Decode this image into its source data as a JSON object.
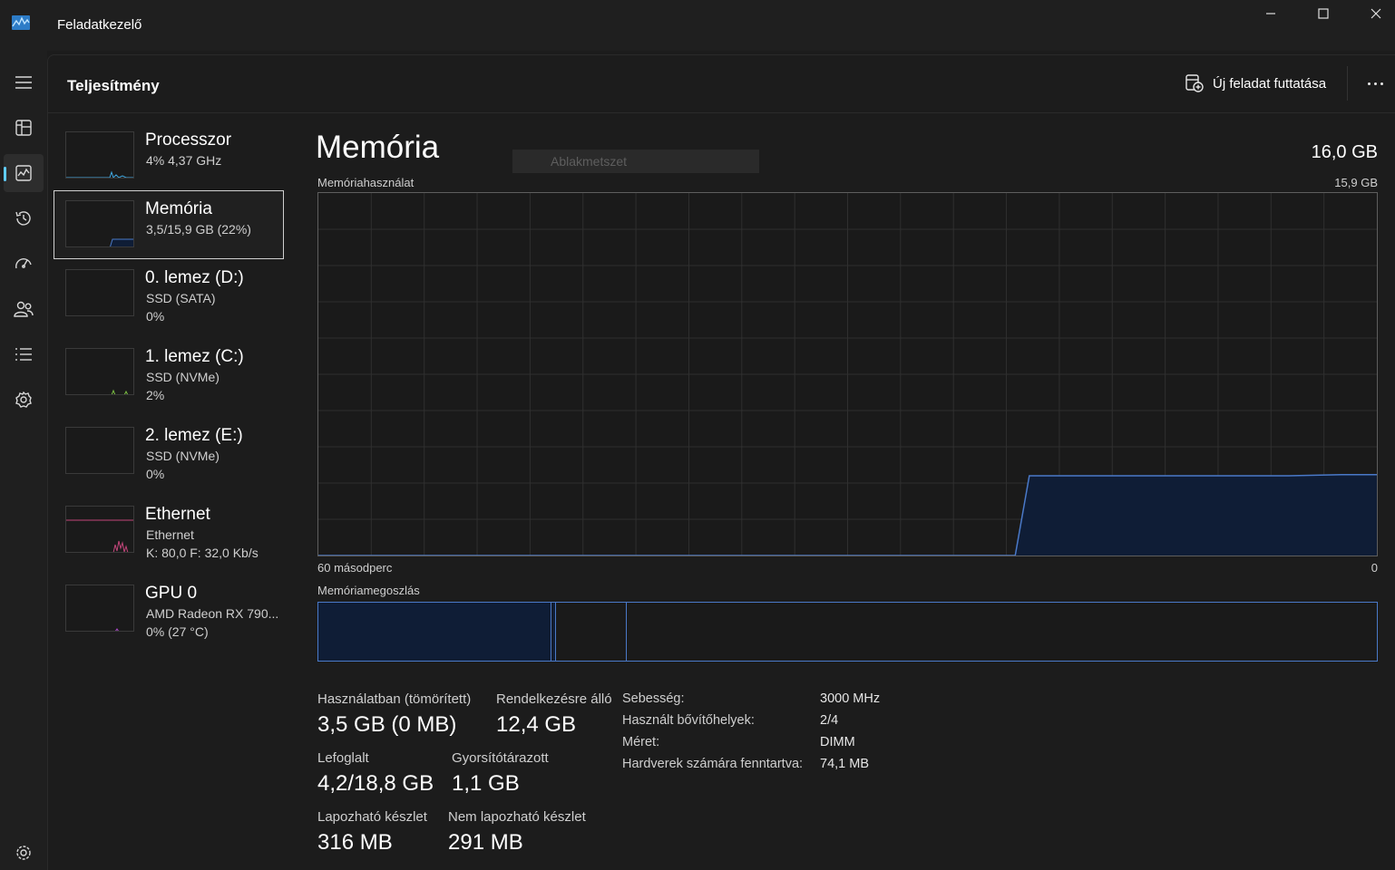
{
  "window": {
    "title": "Feladatkezelő",
    "icon": "task-manager-icon"
  },
  "rail": {
    "items": [
      {
        "name": "hamburger-menu-icon"
      },
      {
        "name": "processes-icon"
      },
      {
        "name": "performance-icon",
        "active": true
      },
      {
        "name": "app-history-icon"
      },
      {
        "name": "startup-apps-icon"
      },
      {
        "name": "users-icon"
      },
      {
        "name": "details-icon"
      },
      {
        "name": "services-icon"
      },
      {
        "name": "settings-icon"
      }
    ]
  },
  "header": {
    "title": "Teljesítmény",
    "run_task_label": "Új feladat futtatása",
    "more_icon": "more-horizontal-icon"
  },
  "resources": [
    {
      "name": "Processzor",
      "line1": "4%  4,37 GHz",
      "line2": ""
    },
    {
      "name": "Memória",
      "line1": "3,5/15,9 GB (22%)",
      "line2": "",
      "selected": true
    },
    {
      "name": "0. lemez (D:)",
      "line1": "SSD (SATA)",
      "line2": "0%"
    },
    {
      "name": "1. lemez (C:)",
      "line1": "SSD (NVMe)",
      "line2": "2%"
    },
    {
      "name": "2. lemez (E:)",
      "line1": "SSD (NVMe)",
      "line2": "0%"
    },
    {
      "name": "Ethernet",
      "line1": "Ethernet",
      "line2": "K: 80,0  F: 32,0 Kb/s"
    },
    {
      "name": "GPU 0",
      "line1": "AMD Radeon RX 790...",
      "line2": "0%  (27 °C)"
    }
  ],
  "detail": {
    "title": "Memória",
    "snapshot_label": "Ablakmetszet",
    "total": "16,0 GB",
    "usage_label": "Memóriahasználat",
    "usage_max": "15,9 GB",
    "time_left": "60 másodperc",
    "time_right": "0",
    "composition_label": "Memóriamegoszlás"
  },
  "colors": {
    "accent": "#60cdff",
    "memory_line": "#4a79c8",
    "memory_fill": "#0f1d36"
  },
  "chart_data": {
    "type": "area",
    "title": "Memóriahasználat",
    "xlabel": "",
    "ylabel": "",
    "x_range_seconds": [
      60,
      0
    ],
    "ylim": [
      0,
      15.9
    ],
    "y_unit": "GB",
    "series": [
      {
        "name": "",
        "x": [
          60,
          20.5,
          19.7,
          15,
          10,
          5,
          2,
          0
        ],
        "y": [
          0,
          0,
          3.5,
          3.5,
          3.5,
          3.5,
          3.55,
          3.55
        ]
      }
    ],
    "grid": true
  },
  "composition": {
    "in_use_fraction": 0.22,
    "modified_fraction": 0.003,
    "standby_fraction": 0.066,
    "free_fraction": 0.711
  },
  "stats": [
    {
      "label": "Használatban (tömörített)",
      "value": "3,5 GB (0 MB)"
    },
    {
      "label": "Rendelkezésre álló",
      "value": "12,4 GB"
    },
    {
      "label": "Lefoglalt",
      "value": "4,2/18,8 GB"
    },
    {
      "label": "Gyorsítótárazott",
      "value": "1,1 GB"
    },
    {
      "label": "Lapozható készlet",
      "value": "316 MB"
    },
    {
      "label": "Nem lapozható készlet",
      "value": "291 MB"
    }
  ],
  "properties": [
    {
      "label": "Sebesség:",
      "value": "3000 MHz"
    },
    {
      "label": "Használt bővítőhelyek:",
      "value": "2/4"
    },
    {
      "label": "Méret:",
      "value": "DIMM"
    },
    {
      "label": "Hardverek számára fenntartva:",
      "value": "74,1 MB"
    }
  ]
}
